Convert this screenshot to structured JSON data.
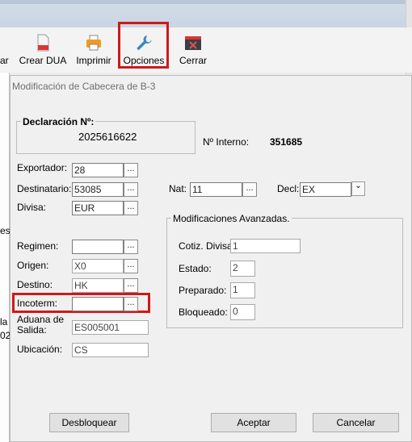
{
  "toolbar": {
    "partial_label": "ar",
    "crear_dua": "Crear DUA",
    "imprimir": "Imprimir",
    "opciones": "Opciones",
    "cerrar": "Cerrar"
  },
  "parent_fragments": [
    "es",
    "la",
    "02"
  ],
  "dialog": {
    "title": "Modificación de Cabecera de B-3",
    "declaracion_label": "Declaración Nº:",
    "declaracion_value": "2025616622",
    "interno_label": "Nº Interno:",
    "interno_value": "351685",
    "exportador_label": "Exportador:",
    "exportador_value": "28",
    "destinatario_label": "Destinatario:",
    "destinatario_value": "53085",
    "divisa_label": "Divisa:",
    "divisa_value": "EUR",
    "nat_label": "Nat:",
    "nat_value": "11",
    "decl_label": "Decl:",
    "decl_value": "EX",
    "regimen_label": "Regimen:",
    "regimen_value": "",
    "origen_label": "Origen:",
    "origen_value": "X0",
    "destino_label": "Destino:",
    "destino_value": "HK",
    "incoterm_label": "Incoterm:",
    "incoterm_value": "",
    "aduana_label_1": "Aduana de",
    "aduana_label_2": "Salida:",
    "aduana_value": "ES005001",
    "ubicacion_label": "Ubicación:",
    "ubicacion_value": "CS",
    "dots_label": "...",
    "advanced": {
      "legend": "Modificaciones Avanzadas.",
      "cotiz_label": "Cotiz. Divisa:",
      "cotiz_value": "1",
      "estado_label": "Estado:",
      "estado_value": "2",
      "preparado_label": "Preparado:",
      "preparado_value": "1",
      "bloqueado_label": "Bloqueado:",
      "bloqueado_value": "0"
    },
    "buttons": {
      "desbloquear": "Desbloquear",
      "aceptar": "Aceptar",
      "cancelar": "Cancelar"
    }
  },
  "colors": {
    "highlight": "#d01818",
    "wrench": "#3b86c4",
    "printer": "#f29a1d"
  }
}
